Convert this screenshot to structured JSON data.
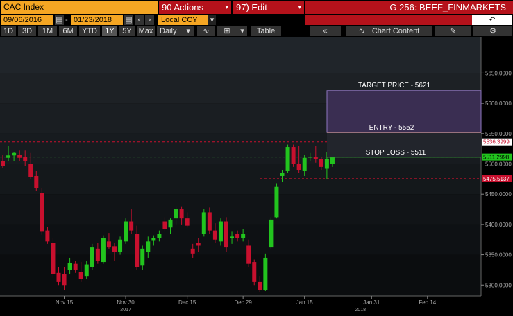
{
  "header": {
    "ticker": "CAC Index",
    "actions_label": "90 Actions",
    "edit_label": "97) Edit",
    "title": "G 256: BEEF_FINMARKETS",
    "start_date": "09/06/2016",
    "end_date": "01/23/2018",
    "currency": "Local CCY",
    "date_separator": "-"
  },
  "toolbar": {
    "periods": [
      "1D",
      "3D",
      "1M",
      "6M",
      "YTD",
      "1Y",
      "5Y",
      "Max"
    ],
    "selected_period": "1Y",
    "frequency": "Daily",
    "table_label": "Table",
    "chart_content_label": "Chart Content"
  },
  "annotations": {
    "target": "TARGET PRICE - 5621",
    "entry": "ENTRY - 5552",
    "stop": "STOP LOSS - 5511"
  },
  "price_tags": {
    "upper": "5536.3999",
    "stop": "5511.2998",
    "lower": "5475.5137"
  },
  "colors": {
    "up": "#22c41e",
    "down": "#c8102e",
    "accent": "#f5a623",
    "header_red": "#b5121b"
  },
  "chart_data": {
    "type": "candlestick",
    "y_ticks": [
      5300,
      5350,
      5400,
      5450,
      5500,
      5550,
      5600,
      5650
    ],
    "y_tick_labels": [
      "5300.0000",
      "5350.0000",
      "5400.0000",
      "5450.0000",
      "5500.0000",
      "5550.0000",
      "5600.0000",
      "5650.0000"
    ],
    "ylim": [
      5282,
      5710
    ],
    "x_tick_labels": [
      {
        "label": "Nov 15",
        "index": 11
      },
      {
        "label": "Nov 30",
        "index": 22
      },
      {
        "label": "Dec 15",
        "index": 33
      },
      {
        "label": "Dec 29",
        "index": 43
      },
      {
        "label": "Jan 15",
        "index": 54
      },
      {
        "label": "Jan 31",
        "index": 66
      },
      {
        "label": "Feb 14",
        "index": 76
      }
    ],
    "year_labels": [
      {
        "label": "2017",
        "index": 22
      },
      {
        "label": "2018",
        "index": 64
      }
    ],
    "target_price": 5621,
    "entry_price": 5552,
    "stop_loss": 5511,
    "levels": [
      5536.3999,
      5511.2998,
      5475.5137
    ],
    "candles": [
      [
        5505,
        5515,
        5493,
        5497
      ],
      [
        5510,
        5530,
        5505,
        5514
      ],
      [
        5514,
        5520,
        5505,
        5518
      ],
      [
        5515,
        5522,
        5505,
        5510
      ],
      [
        5512,
        5522,
        5496,
        5505
      ],
      [
        5500,
        5518,
        5475,
        5478
      ],
      [
        5480,
        5488,
        5455,
        5460
      ],
      [
        5452,
        5460,
        5383,
        5388
      ],
      [
        5390,
        5396,
        5368,
        5372
      ],
      [
        5370,
        5378,
        5312,
        5318
      ],
      [
        5320,
        5330,
        5300,
        5305
      ],
      [
        5318,
        5330,
        5292,
        5300
      ],
      [
        5325,
        5345,
        5318,
        5336
      ],
      [
        5335,
        5340,
        5320,
        5325
      ],
      [
        5322,
        5338,
        5305,
        5310
      ],
      [
        5315,
        5340,
        5310,
        5334
      ],
      [
        5330,
        5368,
        5325,
        5362
      ],
      [
        5360,
        5370,
        5335,
        5340
      ],
      [
        5338,
        5382,
        5335,
        5378
      ],
      [
        5372,
        5386,
        5360,
        5362
      ],
      [
        5364,
        5370,
        5340,
        5355
      ],
      [
        5355,
        5380,
        5350,
        5375
      ],
      [
        5372,
        5410,
        5368,
        5405
      ],
      [
        5405,
        5425,
        5385,
        5390
      ],
      [
        5385,
        5398,
        5325,
        5330
      ],
      [
        5332,
        5365,
        5325,
        5360
      ],
      [
        5355,
        5380,
        5345,
        5372
      ],
      [
        5373,
        5382,
        5365,
        5378
      ],
      [
        5378,
        5390,
        5372,
        5385
      ],
      [
        5405,
        5412,
        5388,
        5392
      ],
      [
        5395,
        5410,
        5385,
        5408
      ],
      [
        5410,
        5430,
        5400,
        5425
      ],
      [
        5425,
        5430,
        5400,
        5410
      ],
      [
        5410,
        5420,
        5395,
        5398
      ],
      [
        5360,
        5368,
        5345,
        5352
      ],
      [
        5370,
        5378,
        5355,
        5365
      ],
      [
        5385,
        5425,
        5380,
        5420
      ],
      [
        5420,
        5428,
        5385,
        5390
      ],
      [
        5390,
        5402,
        5370,
        5375
      ],
      [
        5372,
        5410,
        5365,
        5405
      ],
      [
        5405,
        5412,
        5355,
        5362
      ],
      [
        5378,
        5388,
        5368,
        5380
      ],
      [
        5385,
        5390,
        5372,
        5378
      ],
      [
        5378,
        5392,
        5372,
        5385
      ],
      [
        5365,
        5375,
        5330,
        5335
      ],
      [
        5338,
        5342,
        5300,
        5305
      ],
      [
        5305,
        5315,
        5288,
        5292
      ],
      [
        5292,
        5352,
        5290,
        5345
      ],
      [
        5362,
        5412,
        5360,
        5408
      ],
      [
        5412,
        5468,
        5410,
        5462
      ],
      [
        5480,
        5490,
        5470,
        5485
      ],
      [
        5488,
        5532,
        5485,
        5528
      ],
      [
        5528,
        5532,
        5495,
        5500
      ],
      [
        5500,
        5530,
        5485,
        5490
      ],
      [
        5488,
        5515,
        5480,
        5510
      ],
      [
        5512,
        5518,
        5505,
        5512
      ],
      [
        5512,
        5530,
        5502,
        5508
      ],
      [
        5508,
        5512,
        5490,
        5495
      ],
      [
        5492,
        5520,
        5475,
        5508
      ],
      [
        5500,
        5530,
        5495,
        5524
      ],
      [
        5520,
        5545,
        5515,
        5540
      ]
    ]
  }
}
